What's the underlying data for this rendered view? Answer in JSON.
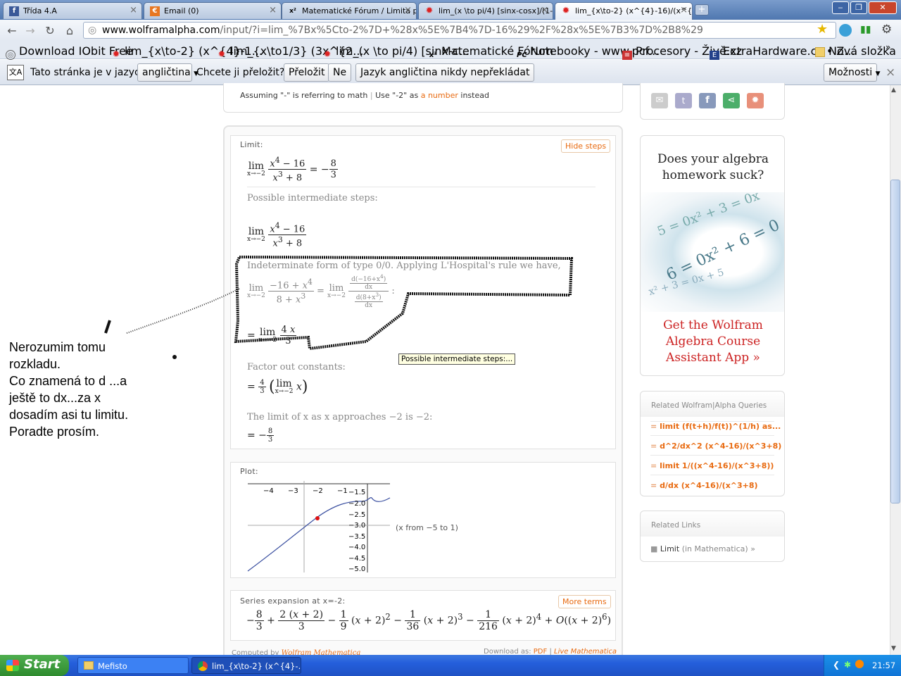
{
  "tabs": [
    {
      "title": "Třída 4.A",
      "icon": "facebook-icon"
    },
    {
      "title": "Email (0)",
      "icon": "email-icon"
    },
    {
      "title": "Matematické Fórum / Limita při",
      "icon": "x2-icon"
    },
    {
      "title": "lim_(x \\to pi/4) [sinx-cosx]/(1-",
      "icon": "wolfram-icon"
    },
    {
      "title": "lim_{x\\to-2} (x^{4}-16)/(x^{3",
      "icon": "wolfram-icon"
    }
  ],
  "url": {
    "domain": "www.wolframalpha.com",
    "path": "/input/?i=lim_%7Bx%5Cto-2%7D+%28x%5E%7B4%7D-16%29%2F%28x%5E%7B3%7D%2B8%29"
  },
  "bookmarks": [
    "Download IObit Free",
    "lim_{x\\to-2} (x^{4}-1...",
    "lim_{x\\to1/3} (3x^{2...",
    "lim_(x \\to pi/4) [sinx-c...",
    "Matematické Fórum",
    "Notebooky - www.pcf...",
    "Procesory - Živě.cz",
    "ExtraHardware.cz • Z...",
    "Nová složka"
  ],
  "translate": {
    "prefix": "Tato stránka je v jazyce",
    "language": "angličtina",
    "question": "Chcete ji přeložit?",
    "translate_btn": "Přeložit",
    "no_btn": "Ne",
    "never_btn": "Jazyk angličtina nikdy nepřekládat",
    "options_btn": "Možnosti",
    "close": "×"
  },
  "assuming": {
    "text": "Assuming \"-\" is referring to math",
    "sep": "|",
    "use": "Use \"-2\" as",
    "link": "a number",
    "instead": "instead"
  },
  "limit_pod": {
    "title": "Limit:",
    "hide_steps": "Hide steps",
    "steps_title": "Possible intermediate steps:",
    "lhospital": "Indeterminate form of type 0/0. Applying L'Hospital's rule we have,",
    "factor": "Factor out constants:",
    "limit_text": "The limit of x as x approaches −2 is −2:"
  },
  "tooltip": "Possible intermediate steps:...",
  "plot": {
    "title": "Plot:",
    "x_ticks": [
      "−4",
      "−3",
      "−2",
      "−1"
    ],
    "y_ticks": [
      "−1.5",
      "−2.0",
      "−2.5",
      "−3.0",
      "−3.5",
      "−4.0",
      "−4.5",
      "−5.0"
    ],
    "range_label": "(x from −5 to 1)"
  },
  "series_pod": {
    "title": "Series expansion at x=-2:",
    "more_terms": "More terms"
  },
  "footer": {
    "computed": "Computed by",
    "computed_link": "Wolfram Mathematica",
    "download": "Download as:",
    "pdf": "PDF",
    "live": "Live Mathematica"
  },
  "ad": {
    "headline": "Does your algebra homework suck?",
    "cta": "Get the Wolfram Algebra Course Assistant App »"
  },
  "related_queries": {
    "title": "Related Wolfram|Alpha Queries",
    "items": [
      "limit (f(t+h)/f(t))^(1/h) as...",
      "d^2/dx^2 (x^4-16)/(x^3+8)",
      "limit 1/((x^4-16)/(x^3+8))",
      "d/dx (x^4-16)/(x^3+8)"
    ]
  },
  "related_links": {
    "title": "Related Links",
    "item": "Limit",
    "item_suffix": "(in Mathematica) »"
  },
  "note": {
    "lines": [
      "Nerozumim tomu",
      "rozkladu.",
      "Co znamená to d ...a",
      "ještě to dx...za x",
      "dosadím asi tu limitu.",
      "Poradte prosím."
    ]
  },
  "taskbar": {
    "start": "Start",
    "task1": "Mefisto",
    "task2": "lim_{x\\to-2} (x^{4}-...",
    "clock": "21:57"
  },
  "colors": {
    "accent": "#e86a10",
    "ad_red": "#cc2222",
    "plot_line": "#3a4fa0",
    "plot_point": "#dd1111"
  }
}
